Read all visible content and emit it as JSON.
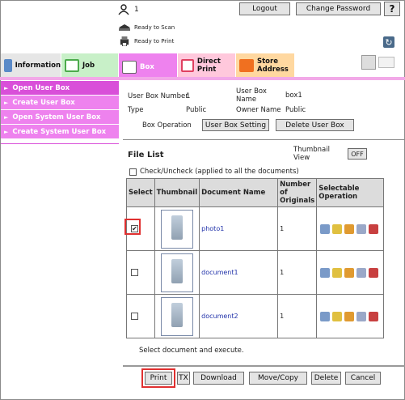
{
  "header": {
    "user_count": "1",
    "logout_label": "Logout",
    "change_password_label": "Change Password",
    "help_label": "?",
    "status_scan": "Ready to Scan",
    "status_print": "Ready to Print"
  },
  "tabs": [
    {
      "label": "Information",
      "icon": "info-icon",
      "color": "#e6e6e6"
    },
    {
      "label": "Job",
      "icon": "job-icon",
      "color": "#c8f0c8"
    },
    {
      "label": "Box",
      "icon": "box-icon",
      "color": "#ee82ee"
    },
    {
      "label": "Direct Print",
      "icon": "direct-print-icon",
      "color": "#ffc8dc"
    },
    {
      "label": "Store Address",
      "icon": "store-address-icon",
      "color": "#ffd8a0"
    }
  ],
  "sidebar": {
    "items": [
      {
        "label": "Open User Box"
      },
      {
        "label": "Create User Box"
      },
      {
        "label": "Open System User Box"
      },
      {
        "label": "Create System User Box"
      }
    ]
  },
  "box_info": {
    "number_label": "User Box Number",
    "number_value": "1",
    "name_label": "User Box Name",
    "name_value": "box1",
    "type_label": "Type",
    "type_value": "Public",
    "owner_label": "Owner Name",
    "owner_value": "Public",
    "operation_label": "Box Operation",
    "setting_button": "User Box Setting",
    "delete_box_button": "Delete User Box"
  },
  "file_list": {
    "title": "File List",
    "thumbnail_view_label": "Thumbnail View",
    "thumbnail_toggle": "OFF",
    "check_all_label": "Check/Uncheck (applied to all the documents)",
    "columns": [
      "Select",
      "Thumbnail",
      "Document Name",
      "Number of Originals",
      "Selectable Operation"
    ],
    "rows": [
      {
        "name": "photo1",
        "originals": "1",
        "checked": "✔"
      },
      {
        "name": "document1",
        "originals": "1",
        "checked": ""
      },
      {
        "name": "document2",
        "originals": "1",
        "checked": ""
      }
    ],
    "instruction": "Select document and execute."
  },
  "actions": {
    "print": "Print",
    "tx": "TX",
    "download": "Download",
    "move_copy": "Move/Copy",
    "delete": "Delete",
    "cancel": "Cancel"
  },
  "colors": {
    "sidebar": "#ee82ee",
    "sidebar_active": "#d94fd9",
    "highlight": "#e03030"
  }
}
